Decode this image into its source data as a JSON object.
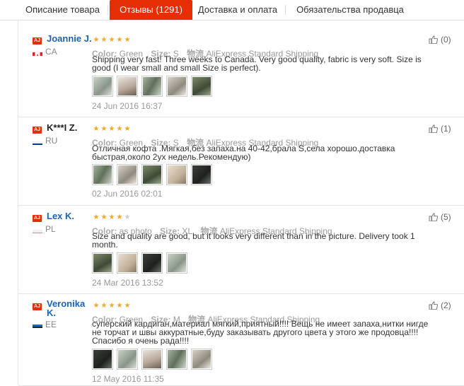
{
  "tabs": [
    {
      "label": "Описание товара"
    },
    {
      "label": "Отзывы (1291)"
    },
    {
      "label": "Доставка и оплата"
    },
    {
      "label": "Обязательства продавца"
    }
  ],
  "labels": {
    "badge": "AJ",
    "color": "Color:",
    "size": "Size:",
    "logistics": "物流",
    "shipping": "AliExpress Standard Shipping"
  },
  "colors": {
    "accent": "#e62e04",
    "link": "#1a64b4",
    "star": "#f5a623"
  },
  "reviews": [
    {
      "name": "Joannie J.",
      "country": "CA",
      "flag": "canada",
      "rating": 5,
      "color": "Green",
      "size": "S",
      "text": "Shipping very fast! Three weeks to Canada. Very good quality, fabric is very soft. Size is good (I wear small and small Size is perfect).",
      "photos": 5,
      "date": "24 Jun 2016 16:37",
      "likes": "(0)"
    },
    {
      "name": "K***I Z.",
      "country": "RU",
      "flag": "russia",
      "rating": 5,
      "color": "Green",
      "size": "S",
      "text": "Отличная кофта .Мягкая,без запаха.на 40-42,брала S,села хорошо.доставка быстрая,около 2ух недель.Рекомендую)",
      "photos": 5,
      "date": "02 Jun 2016 02:01",
      "likes": "(1)"
    },
    {
      "name": "Lex K.",
      "country": "PL",
      "flag": "poland",
      "rating": 4,
      "color": "as photo",
      "size": "XL",
      "text": "Size and quality are good, but it looks very different than in the picture. Delivery took 1 month.",
      "photos": 4,
      "date": "24 Mar 2016 13:52",
      "likes": "(5)"
    },
    {
      "name": "Veronika K.",
      "country": "EE",
      "flag": "estonia",
      "rating": 5,
      "color": "Green",
      "size": "M",
      "text": "суперский кардиган,материал мягкий,приятный!!!! Вещь не имеет запаха,нитки нигде не торчат и швы аккуратные,буду заказывать другого цвета у этого же продовца!!!! Спасибо я очень рада!!!!",
      "photos": 5,
      "date": "12 May 2016 11:35",
      "likes": "(2)"
    }
  ]
}
